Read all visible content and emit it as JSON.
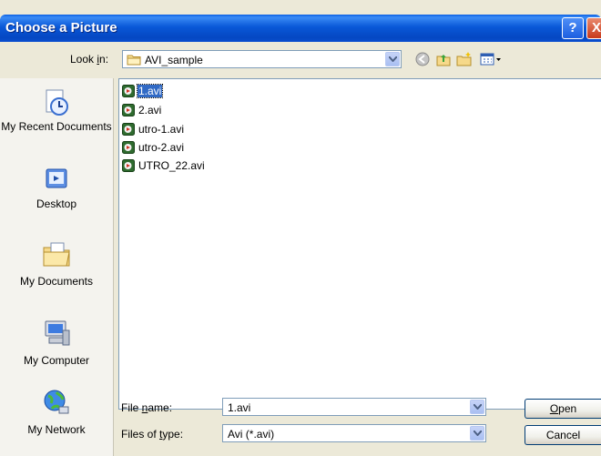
{
  "dialog": {
    "title": "Choose a Picture",
    "help_glyph": "?",
    "close_glyph": "X"
  },
  "toolbar": {
    "look_in_label": "Look in:",
    "look_in_value": "AVI_sample",
    "icons": [
      "back-icon",
      "up-folder-icon",
      "new-folder-icon",
      "views-menu-icon"
    ]
  },
  "places": [
    {
      "label": "My Recent Documents",
      "icon": "recent-documents-icon"
    },
    {
      "label": "Desktop",
      "icon": "desktop-icon"
    },
    {
      "label": "My Documents",
      "icon": "my-documents-icon"
    },
    {
      "label": "My Computer",
      "icon": "my-computer-icon"
    },
    {
      "label": "My Network",
      "icon": "my-network-icon"
    }
  ],
  "files": [
    {
      "name": "1.avi",
      "selected": true
    },
    {
      "name": "2.avi",
      "selected": false
    },
    {
      "name": "utro-1.avi",
      "selected": false
    },
    {
      "name": "utro-2.avi",
      "selected": false
    },
    {
      "name": "UTRO_22.avi",
      "selected": false
    }
  ],
  "footer": {
    "file_name_label": "File name:",
    "file_name_value": "1.avi",
    "file_type_label": "Files of type:",
    "file_type_value": "Avi (*.avi)",
    "open_label": "Open",
    "cancel_label": "Cancel"
  },
  "colors": {
    "titlebar": "#0a56d6",
    "selection": "#316ac5",
    "dialog_bg": "#ece9d8"
  }
}
